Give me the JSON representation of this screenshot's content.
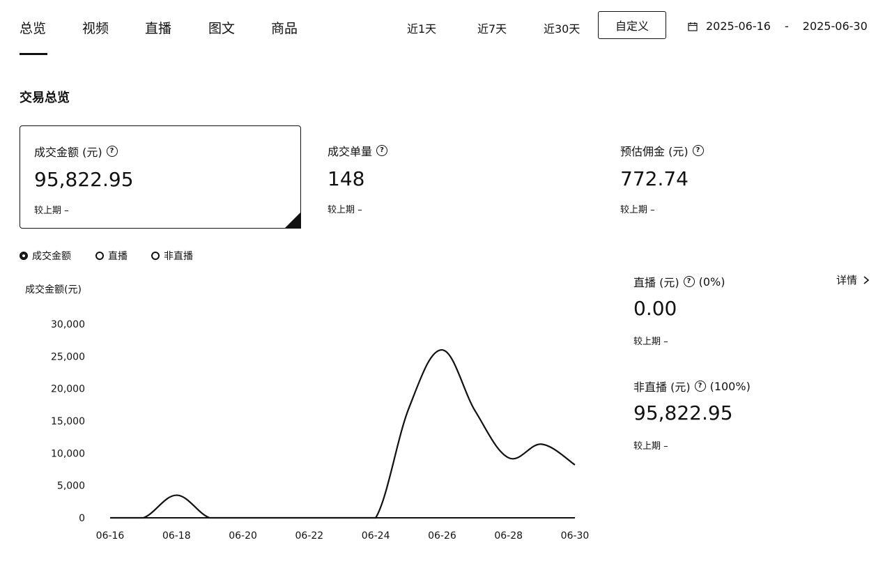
{
  "tabs": [
    {
      "label": "总览",
      "active": true
    },
    {
      "label": "视频"
    },
    {
      "label": "直播"
    },
    {
      "label": "图文"
    },
    {
      "label": "商品"
    }
  ],
  "ranges": {
    "r1": "近1天",
    "r7": "近7天",
    "r30": "近30天",
    "custom": "自定义"
  },
  "date_range": {
    "start": "2025-06-16",
    "separator": "-",
    "end": "2025-06-30"
  },
  "section_title": "交易总览",
  "cards": [
    {
      "label": "成交金额 (元)",
      "value": "95,822.95",
      "compare": "较上期 –"
    },
    {
      "label": "成交单量",
      "value": "148",
      "compare": "较上期 –"
    },
    {
      "label": "预估佣金 (元)",
      "value": "772.74",
      "compare": "较上期 –"
    }
  ],
  "legend": [
    {
      "label": "成交金额",
      "selected": true
    },
    {
      "label": "直播",
      "selected": false
    },
    {
      "label": "非直播",
      "selected": false
    }
  ],
  "side": {
    "live": {
      "label": "直播 (元)",
      "percent": "(0%)",
      "value": "0.00",
      "compare": "较上期 –"
    },
    "nonlive": {
      "label": "非直播 (元)",
      "percent": "(100%)",
      "value": "95,822.95",
      "compare": "较上期 –"
    },
    "detail": "详情"
  },
  "chart_data": {
    "type": "line",
    "ylabel": "成交金额(元)",
    "yticks": [
      "0",
      "5,000",
      "10,000",
      "15,000",
      "20,000",
      "25,000",
      "30,000"
    ],
    "ylim": [
      0,
      30000
    ],
    "xticks": [
      "06-16",
      "06-18",
      "06-20",
      "06-22",
      "06-24",
      "06-26",
      "06-28",
      "06-30"
    ],
    "x": [
      "06-16",
      "06-17",
      "06-18",
      "06-19",
      "06-20",
      "06-21",
      "06-22",
      "06-23",
      "06-24",
      "06-25",
      "06-26",
      "06-27",
      "06-28",
      "06-29",
      "06-30"
    ],
    "series": [
      {
        "values": [
          0,
          0,
          3500,
          0,
          0,
          0,
          0,
          0,
          0,
          17000,
          26000,
          16500,
          9300,
          11400,
          8200
        ]
      }
    ],
    "grid": false,
    "color": "#111111"
  }
}
